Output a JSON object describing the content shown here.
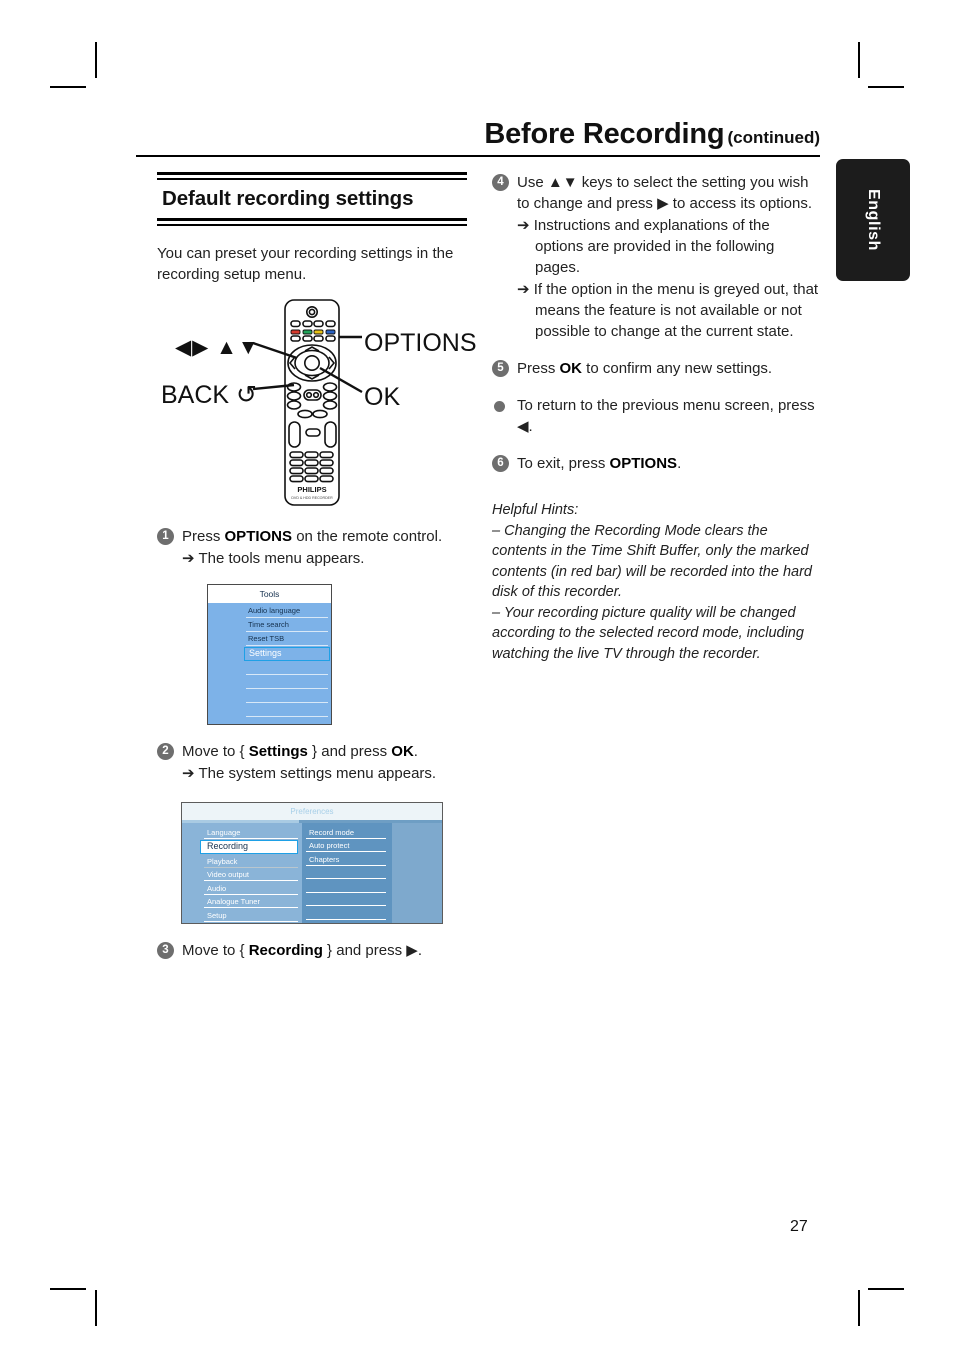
{
  "header": {
    "chapter_title": "Before Recording",
    "continued": "(continued)",
    "language_tab": "English"
  },
  "left_column": {
    "section_heading": "Default recording settings",
    "intro": "You can preset your recording settings in the recording setup menu.",
    "remote_callouts": {
      "options": "OPTIONS",
      "ok": "OK",
      "back": "BACK ↺",
      "arrows": "◀▶ ▲▼",
      "brand": "PHILIPS"
    },
    "steps": [
      {
        "num": "1",
        "text_before": "Press ",
        "bold": "OPTIONS",
        "text_after": " on the remote control.",
        "sub": "➔ The tools menu appears."
      },
      {
        "num": "2",
        "text_before": "Move to { ",
        "bold": "Settings",
        "text_after": " } and press ",
        "bold2": "OK",
        "text_end": ".",
        "sub": "➔ The system settings menu appears."
      },
      {
        "num": "3",
        "text_before": "Move to { ",
        "bold": "Recording",
        "text_after": " } and press ▶."
      }
    ],
    "tools_menu": {
      "title": "Tools",
      "items": [
        "Audio language",
        "Time search",
        "Reset TSB"
      ],
      "selected_item": "Settings",
      "blank_rows": 4
    },
    "settings_menu": {
      "title": "Preferences",
      "left_items": [
        "Language",
        "Playback",
        "Video output",
        "Audio",
        "Analogue Tuner",
        "Setup"
      ],
      "left_selected": "Recording",
      "middle_items": [
        "Record mode",
        "Auto protect",
        "Chapters"
      ],
      "middle_blank_rows": 5,
      "right_blank_rows": 8
    }
  },
  "right_column": {
    "steps": [
      {
        "num": "4",
        "line1": "Use ▲▼ keys to select the setting you wish to change and press ▶ to access its options.",
        "sub1": "➔ Instructions and explanations of the options are provided in the following pages.",
        "sub2": "➔ If the option in the menu is greyed out, that means the feature is not available or not possible to change at the current state."
      },
      {
        "num": "5",
        "text_before": "Press ",
        "bold": "OK",
        "text_after": " to confirm any new settings."
      },
      {
        "bullet": true,
        "text": "To return to the previous menu screen, press ◀."
      },
      {
        "num": "6",
        "text_before": "To exit, press ",
        "bold": "OPTIONS",
        "text_after": "."
      }
    ],
    "hints": {
      "title": "Helpful Hints:",
      "items": [
        "–  Changing the Recording Mode clears the contents in the Time Shift Buffer, only the marked contents (in red bar) will be recorded into the hard disk of this recorder.",
        "–  Your recording picture quality will be changed according to the selected record mode, including watching the live TV through the recorder."
      ]
    }
  },
  "footer": {
    "page_number": "27"
  },
  "colors": {
    "menu_blue": "#7db2e8",
    "settings_blue": "#8ab4d8",
    "highlight_border": "#1ea0e6",
    "tab_black": "#1c1c1c",
    "step_badge": "#6e6e6e"
  }
}
